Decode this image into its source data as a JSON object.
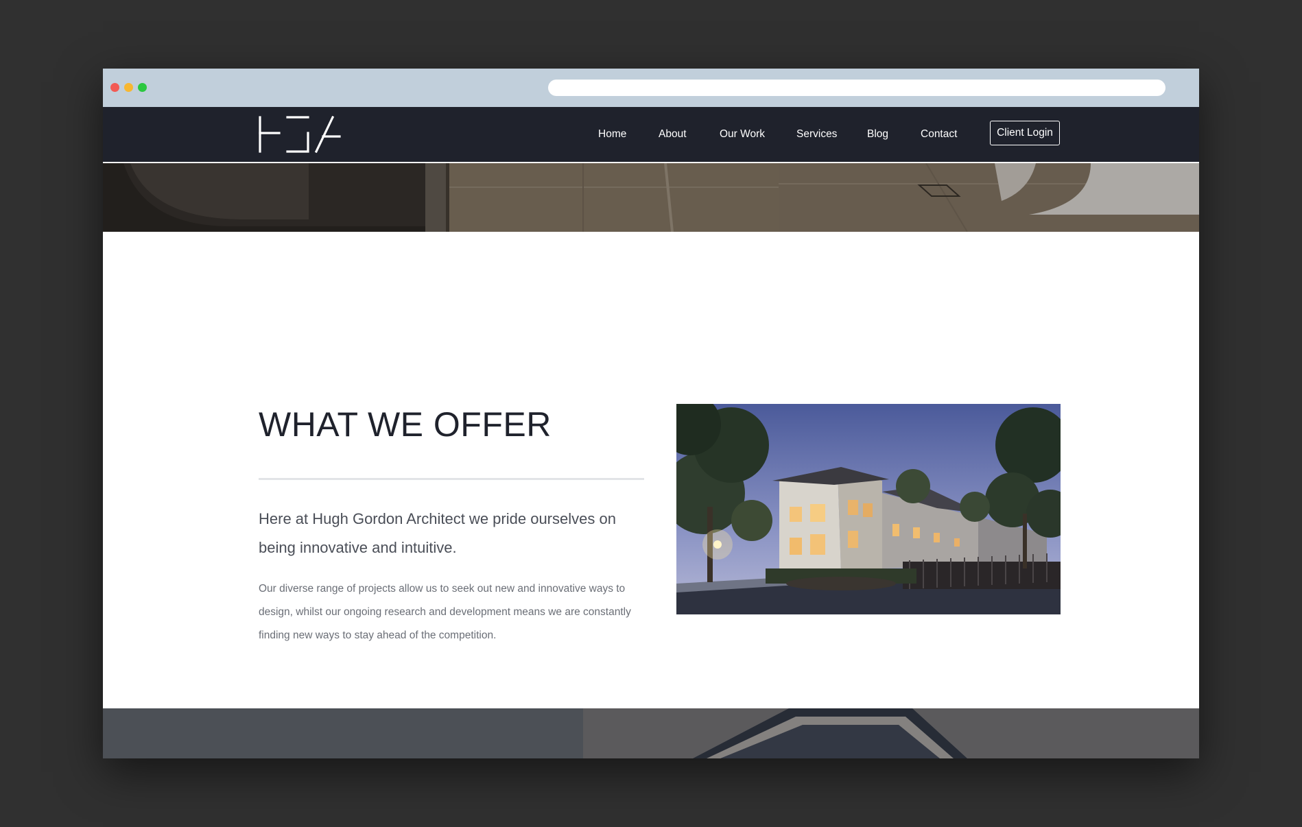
{
  "nav": {
    "items": [
      {
        "label": "Home"
      },
      {
        "label": "About"
      },
      {
        "label": "Our Work"
      },
      {
        "label": "Services"
      },
      {
        "label": "Blog"
      },
      {
        "label": "Contact"
      }
    ],
    "login_label": "Client Login"
  },
  "offer": {
    "title": "WHAT WE OFFER",
    "lead": "Here at Hugh Gordon Architect we pride ourselves on being innovative and intuitive.",
    "body": "Our diverse range of projects allow us to seek out new and innovative ways to design, whilst our ongoing research and development means we are constantly finding new ways to stay ahead of the competition."
  },
  "colors": {
    "header_bg": "#1f222c",
    "chrome_bg": "#c1cfdb",
    "page_bg": "#303030",
    "title_text": "#1f222c"
  },
  "icons": {
    "logo": "hga-logo",
    "window_controls": [
      "close-dot",
      "minimize-dot",
      "maximize-dot"
    ]
  }
}
